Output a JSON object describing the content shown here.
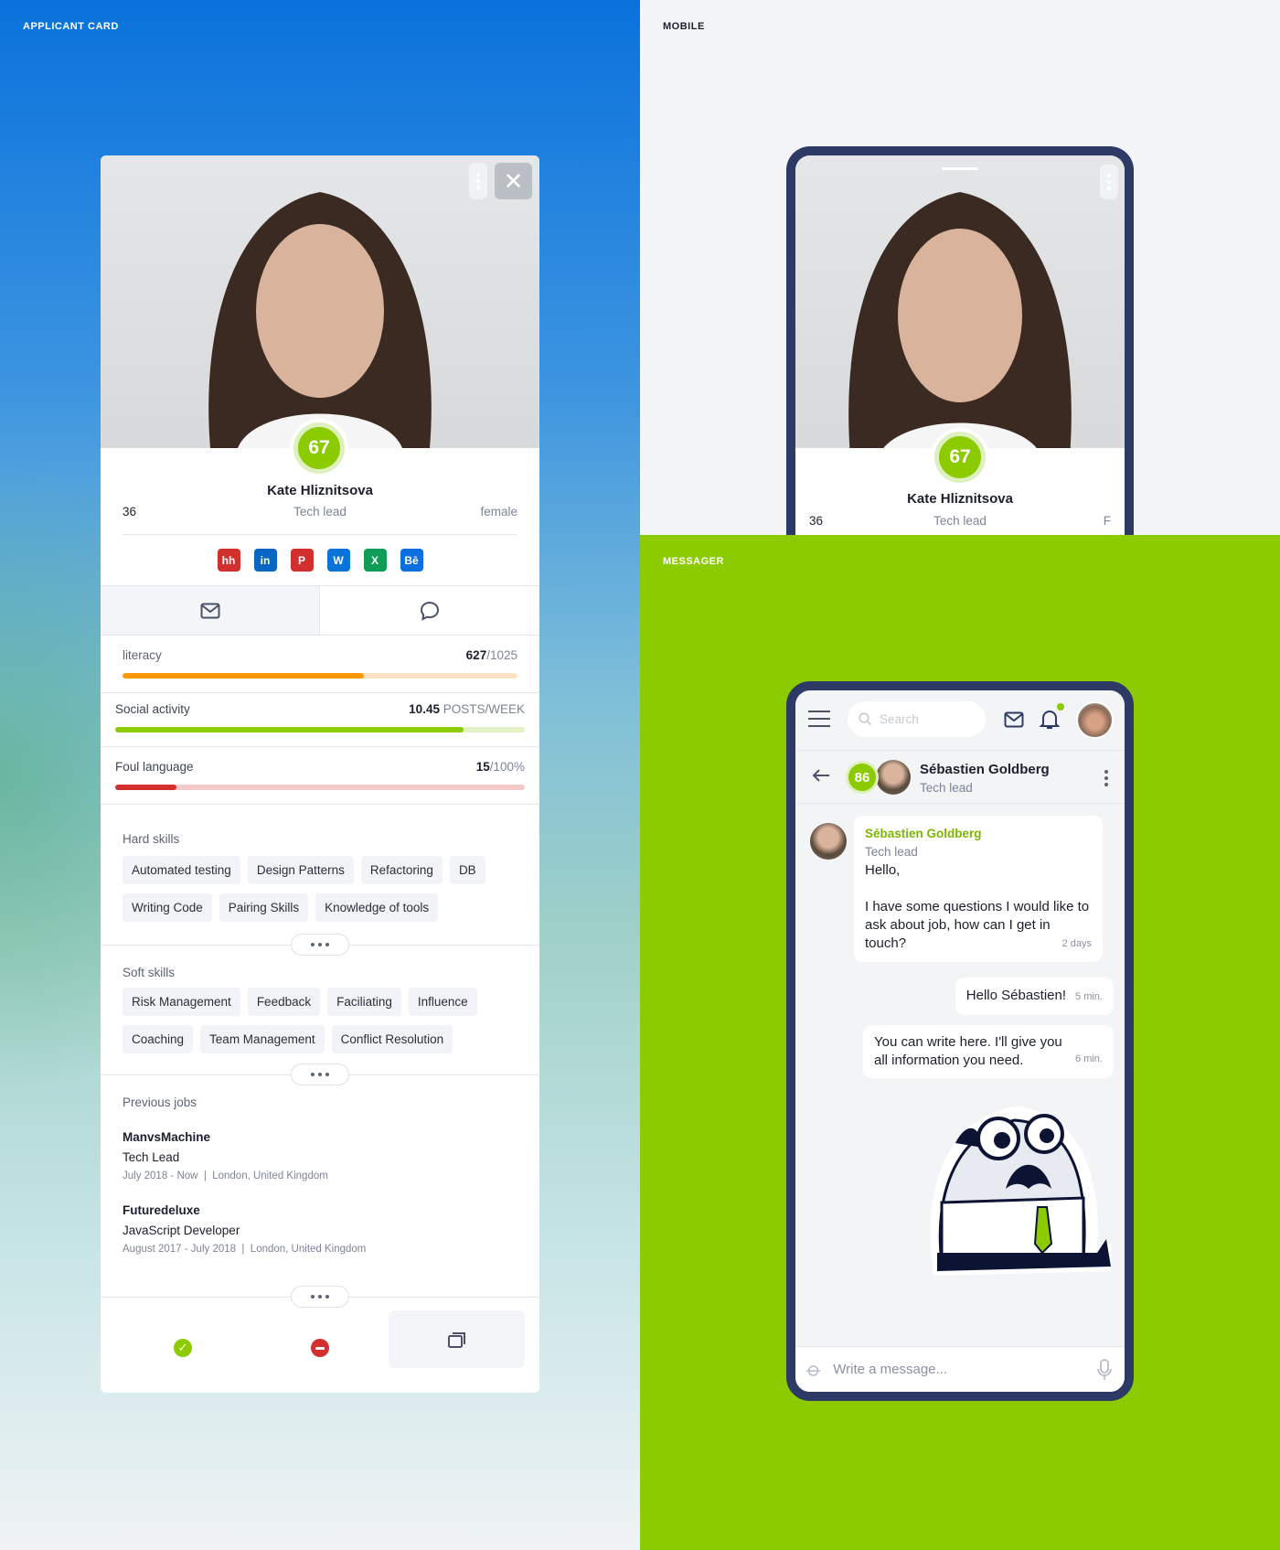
{
  "sections": {
    "applicant": "APPLICANT CARD",
    "mobile": "MOBILE",
    "messager": "MESSAGER"
  },
  "colors": {
    "accent": "#8bcb00",
    "navy": "#2d3a66",
    "orange": "#ff9800",
    "red": "#d32f2f"
  },
  "card": {
    "score": "67",
    "name": "Kate Hliznitsova",
    "age": "36",
    "role": "Tech lead",
    "gender": "female",
    "icons": {
      "menu": "kebab-icon",
      "close": "close-icon",
      "mail": "mail-icon",
      "chat": "chat-bubble-icon"
    },
    "socials": [
      {
        "label": "hh",
        "color": "#d32f2f"
      },
      {
        "label": "in",
        "color": "#0a66c2"
      },
      {
        "label": "P",
        "color": "#d32f2f"
      },
      {
        "label": "W",
        "color": "#0a73d8"
      },
      {
        "label": "X",
        "color": "#0f9d58"
      },
      {
        "label": "Bē",
        "color": "#0a6fe0"
      }
    ],
    "stats": [
      {
        "label": "literacy",
        "value": "627",
        "suffix": "/1025",
        "percent": 61,
        "color": "#ff9800",
        "track": "#fde3c1"
      },
      {
        "label": "Social activity",
        "value": "10.45",
        "suffix": " POSTS/WEEK",
        "percent": 85,
        "color": "#8bcb00",
        "track": "#e3f3c6"
      },
      {
        "label": "Foul language",
        "value": "15",
        "suffix": "/100%",
        "percent": 15,
        "color": "#d32f2f",
        "track": "#f5c9c9"
      }
    ],
    "hard_skills": {
      "title": "Hard skills",
      "items": [
        "Automated testing",
        "Design Patterns",
        "Refactoring",
        "DB",
        "Writing Code",
        "Pairing Skills",
        "Knowledge of tools"
      ]
    },
    "soft_skills": {
      "title": "Soft skills",
      "items": [
        "Risk Management",
        "Feedback",
        "Faciliating",
        "Influence",
        "Coaching",
        "Team Management",
        "Conflict Resolution"
      ]
    },
    "previous_jobs": {
      "title": "Previous jobs",
      "items": [
        {
          "company": "ManvsMachine",
          "title": "Tech Lead",
          "meta": "July 2018 - Now  |  London, United Kingdom"
        },
        {
          "company": "Futuredeluxe",
          "title": "JavaScript Developer",
          "meta": "August 2017 - July 2018  |  London, United Kingdom"
        }
      ]
    }
  },
  "mobile": {
    "score": "67",
    "name": "Kate Hliznitsova",
    "age": "36",
    "role": "Tech lead",
    "gender": "F"
  },
  "messager": {
    "search_placeholder": "Search",
    "contact": {
      "score": "86",
      "name": "Sébastien Goldberg",
      "role": "Tech lead"
    },
    "messages": [
      {
        "sender": "Sébastien Goldberg",
        "role": "Tech lead",
        "text1": "Hello,",
        "text2": "I have some questions I would like to ask about job, how can I get in touch?",
        "time": "2 days"
      },
      {
        "text": "Hello Sébastien!",
        "time": "5 min."
      },
      {
        "text": "You can write here. I'll give you all information you need.",
        "time": "6 min."
      }
    ],
    "input_placeholder": "Write a message..."
  }
}
